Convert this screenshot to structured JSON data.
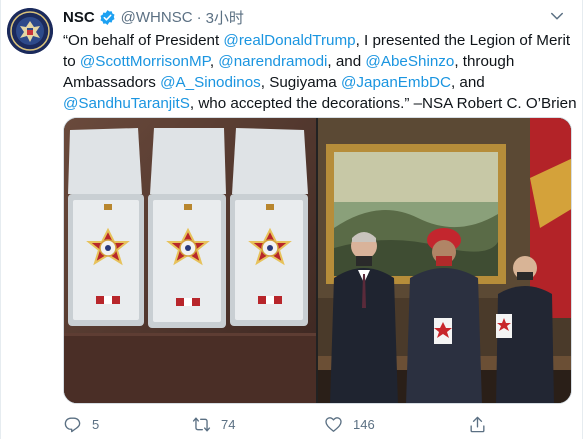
{
  "account": {
    "name": "NSC",
    "handle": "@WHNSC",
    "separator": "·",
    "time": "3小时",
    "verified": true
  },
  "tweet": {
    "segments": [
      {
        "text": "“On behalf of President ",
        "type": "text"
      },
      {
        "text": "@realDonaldTrump",
        "type": "mention"
      },
      {
        "text": ", I presented the Legion of Merit",
        "type": "text"
      },
      {
        "text": " to ",
        "type": "text"
      },
      {
        "text": "@ScottMorrisonMP",
        "type": "mention"
      },
      {
        "text": ", ",
        "type": "text"
      },
      {
        "text": "@narendramodi",
        "type": "mention"
      },
      {
        "text": ", and ",
        "type": "text"
      },
      {
        "text": "@AbeShinzo",
        "type": "mention"
      },
      {
        "text": ", through",
        "type": "text"
      },
      {
        "text": "Ambassadors ",
        "type": "text"
      },
      {
        "text": "@A_Sinodinos",
        "type": "mention"
      },
      {
        "text": ", Sugiyama ",
        "type": "text"
      },
      {
        "text": "@JapanEmbDC",
        "type": "mention"
      },
      {
        "text": ", and",
        "type": "text"
      },
      {
        "text": "@SandhuTaranjitS",
        "type": "mention"
      },
      {
        "text": ", who accepted the decorations.” –NSA Robert C. O’Brien",
        "type": "text"
      }
    ],
    "lines": [
      [
        0,
        1,
        2
      ],
      [
        3,
        4,
        5,
        6,
        7,
        8,
        9
      ],
      [
        10,
        11,
        12,
        13,
        14
      ],
      [
        15,
        16
      ]
    ]
  },
  "media": {
    "left_photo": "legion-of-merit-medal-cases",
    "right_photo": "ambassadors-holding-medals"
  },
  "actions": {
    "reply": {
      "icon": "reply-icon",
      "count": "5"
    },
    "retweet": {
      "icon": "retweet-icon",
      "count": "74"
    },
    "like": {
      "icon": "heart-icon",
      "count": "146"
    },
    "share": {
      "icon": "share-icon",
      "count": ""
    }
  },
  "colors": {
    "mention": "#1b95e0",
    "secondary_text": "#5b7083",
    "verified": "#1da1f2"
  }
}
